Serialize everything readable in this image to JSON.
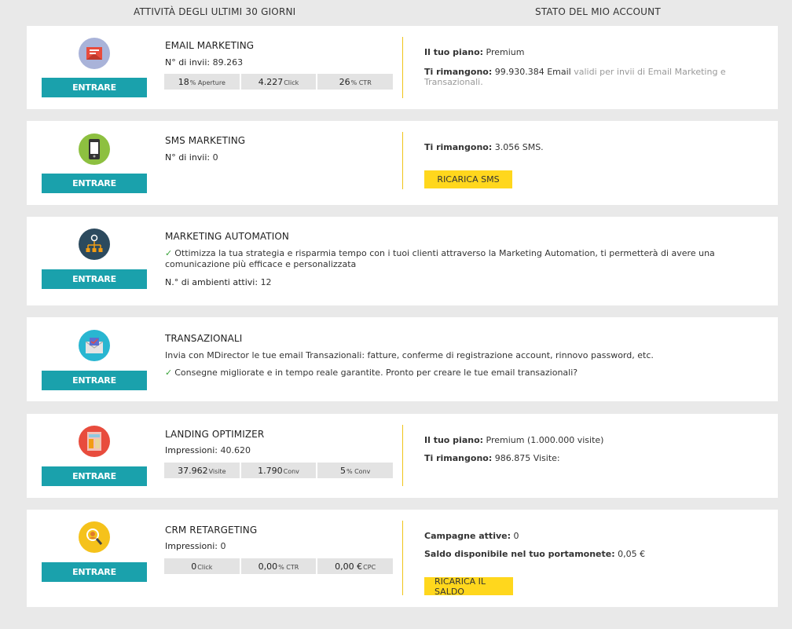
{
  "header": {
    "left_title": "ATTIVITÀ DEGLI ULTIMI 30 GIORNI",
    "right_title": "STATO DEL MIO ACCOUNT"
  },
  "enter_label": "ENTRARE",
  "email": {
    "title": "EMAIL MARKETING",
    "sent_label": "N° di invii:",
    "sent_value": "89.263",
    "stats": [
      {
        "value": "18",
        "unit": "% Aperture"
      },
      {
        "value": "4.227",
        "unit": " Click"
      },
      {
        "value": "26",
        "unit": "% CTR"
      }
    ],
    "plan_label": "Il tuo piano:",
    "plan_value": "Premium",
    "remaining_label": "Ti rimangono:",
    "remaining_value": "99.930.384 Email",
    "remaining_note": "validi per invii di Email Marketing e Transazionali."
  },
  "sms": {
    "title": "SMS MARKETING",
    "sent_label": "N° di invii:",
    "sent_value": "0",
    "remaining_label": "Ti rimangono:",
    "remaining_value": "3.056 SMS.",
    "recharge_label": "RICARICA SMS"
  },
  "automation": {
    "title": "MARKETING AUTOMATION",
    "description": "Ottimizza la tua strategia e risparmia tempo con i tuoi clienti attraverso la Marketing Automation, ti permetterà di avere una comunicazione più efficace e personalizzata",
    "envs_label": "N.° di ambienti attivi:",
    "envs_value": "12"
  },
  "transactional": {
    "title": "TRANSAZIONALI",
    "line1": "Invia con MDirector le tue email Transazionali: fatture, conferme di registrazione account, rinnovo password, etc.",
    "line2": "Consegne migliorate e in tempo reale garantite. Pronto per creare le tue email transazionali?"
  },
  "landing": {
    "title": "LANDING OPTIMIZER",
    "impr_label": "Impressioni:",
    "impr_value": "40.620",
    "stats": [
      {
        "value": "37.962",
        "unit": " Visite"
      },
      {
        "value": "1.790",
        "unit": "Conv"
      },
      {
        "value": "5",
        "unit": "% Conv"
      }
    ],
    "plan_label": "Il tuo piano:",
    "plan_value": "Premium (1.000.000 visite)",
    "remaining_label": "Ti rimangono:",
    "remaining_value": "986.875 Visite:"
  },
  "crm": {
    "title": "CRM RETARGETING",
    "impr_label": "Impressioni:",
    "impr_value": "0",
    "stats": [
      {
        "value": "0",
        "unit": " Click"
      },
      {
        "value": "0,00",
        "unit": " % CTR"
      },
      {
        "value": "0,00 €",
        "unit": " CPC"
      }
    ],
    "campaigns_label": "Campagne attive:",
    "campaigns_value": "0",
    "balance_label": "Saldo disponibile nel tuo portamonete:",
    "balance_value": "0,05 €",
    "recharge_label": "RICARICA IL SALDO"
  },
  "colors": {
    "teal": "#1aa1ac",
    "yellow": "#ffd71d",
    "check": "#3aa33a"
  }
}
